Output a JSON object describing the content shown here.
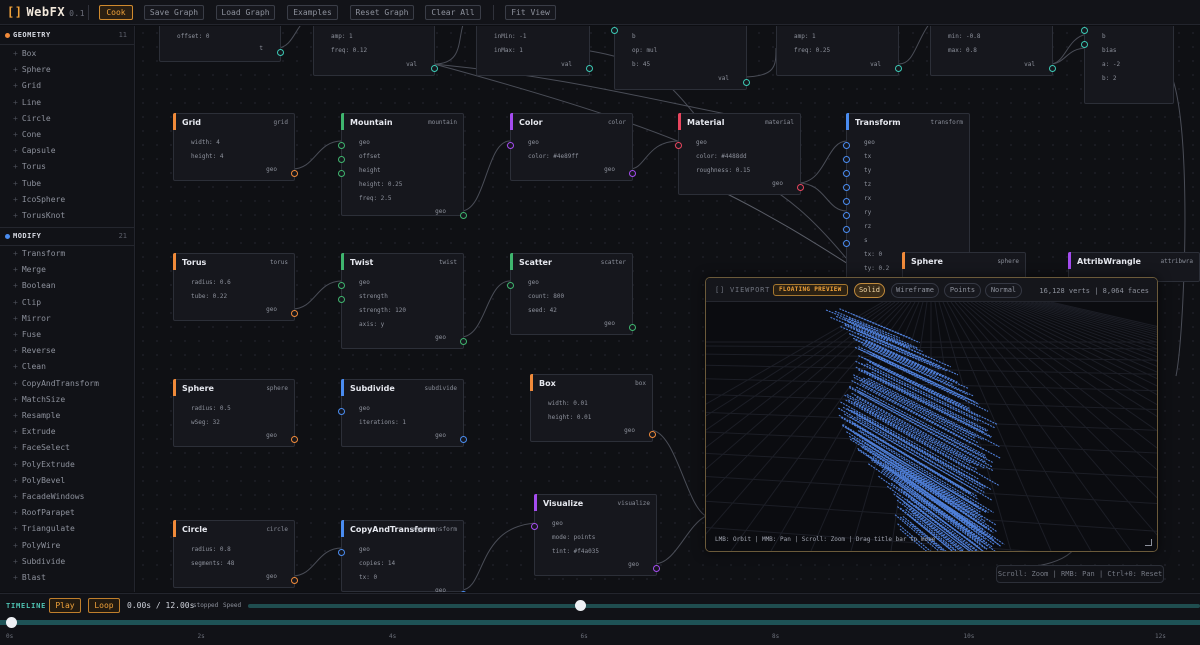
{
  "app": {
    "logo": "[]",
    "title": "WebFX",
    "version": "0.1"
  },
  "toolbar": {
    "cook": "Cook",
    "save": "Save Graph",
    "load": "Load Graph",
    "examples": "Examples",
    "reset": "Reset Graph",
    "clear": "Clear All",
    "fit": "Fit View"
  },
  "sidebar": {
    "geometry": {
      "label": "GEOMETRY",
      "count": "11",
      "color": "#f08a3a",
      "items": [
        "Box",
        "Sphere",
        "Grid",
        "Line",
        "Circle",
        "Cone",
        "Capsule",
        "Torus",
        "Tube",
        "IcoSphere",
        "TorusKnot"
      ]
    },
    "modify": {
      "label": "MODIFY",
      "count": "21",
      "color": "#4a8cf0",
      "items": [
        "Transform",
        "Merge",
        "Boolean",
        "Clip",
        "Mirror",
        "Fuse",
        "Reverse",
        "Clean",
        "CopyAndTransform",
        "MatchSize",
        "Resample",
        "Extrude",
        "FaceSelect",
        "PolyExtrude",
        "PolyBevel",
        "FacadeWindows",
        "RoofParapet",
        "Triangulate",
        "PolyWire",
        "Subdivide",
        "Blast"
      ]
    }
  },
  "nodes": {
    "top1": {
      "params": [
        "offset: 0"
      ],
      "out": "t"
    },
    "top2": {
      "params": [
        "amp: 1",
        "freq: 0.12"
      ],
      "out": "val"
    },
    "top3": {
      "params": [
        "inMin: -1",
        "inMax: 1"
      ],
      "out": "val"
    },
    "top4": {
      "params": [
        "b",
        "op: mul",
        "b: 45"
      ],
      "out": "val"
    },
    "top5": {
      "params": [
        "amp: 1",
        "freq: 0.25"
      ],
      "out": "val"
    },
    "top6": {
      "params": [
        "min: -0.8",
        "max: 0.8"
      ],
      "out": "val"
    },
    "top7": {
      "params": [
        "b",
        "bias",
        "a: -2",
        "b: 2"
      ]
    },
    "grid": {
      "title": "Grid",
      "type": "grid",
      "params": [
        "width: 4",
        "height: 4"
      ],
      "out": "geo"
    },
    "mountain": {
      "title": "Mountain",
      "type": "mountain",
      "params": [
        "geo",
        "offset",
        "height",
        "height: 0.25",
        "freq: 2.5"
      ],
      "out": "geo"
    },
    "color": {
      "title": "Color",
      "type": "color",
      "params": [
        "geo",
        "color: #4e89ff"
      ],
      "out": "geo"
    },
    "material": {
      "title": "Material",
      "type": "material",
      "params": [
        "geo",
        "color: #4488dd",
        "roughness: 0.15"
      ],
      "out": "geo"
    },
    "transform": {
      "title": "Transform",
      "type": "transform",
      "params": [
        "geo",
        "tx",
        "ty",
        "tz",
        "rx",
        "ry",
        "rz",
        "s",
        "tx: 0",
        "ty: 0.2"
      ]
    },
    "sphere2": {
      "title": "Sphere",
      "type": "sphere"
    },
    "attrib": {
      "title": "AttribWrangle",
      "type": "attribwra"
    },
    "torus": {
      "title": "Torus",
      "type": "torus",
      "params": [
        "radius: 0.6",
        "tube: 0.22"
      ],
      "out": "geo"
    },
    "twist": {
      "title": "Twist",
      "type": "twist",
      "params": [
        "geo",
        "strength",
        "strength: 120",
        "axis: y"
      ],
      "out": "geo"
    },
    "scatter": {
      "title": "Scatter",
      "type": "scatter",
      "params": [
        "geo",
        "count: 800",
        "seed: 42"
      ],
      "out": "geo"
    },
    "sphere": {
      "title": "Sphere",
      "type": "sphere",
      "params": [
        "radius: 0.5",
        "wSeg: 32"
      ],
      "out": "geo"
    },
    "subdivide": {
      "title": "Subdivide",
      "type": "subdivide",
      "params": [
        "geo",
        "iterations: 1"
      ],
      "out": "geo"
    },
    "box": {
      "title": "Box",
      "type": "box",
      "params": [
        "width: 0.01",
        "height: 0.01"
      ],
      "out": "geo"
    },
    "visualize": {
      "title": "Visualize",
      "type": "visualize",
      "params": [
        "geo",
        "mode: points",
        "tint: #f4a035"
      ],
      "out": "geo"
    },
    "circle": {
      "title": "Circle",
      "type": "circle",
      "params": [
        "radius: 0.8",
        "segments: 48"
      ],
      "out": "geo"
    },
    "copy": {
      "title": "CopyAndTransform",
      "type": "copytransform",
      "params": [
        "geo",
        "copies: 14",
        "tx: 0"
      ],
      "out": "geo"
    }
  },
  "viewport": {
    "title": "[] VIEWPORT",
    "badge": "FLOATING PREVIEW",
    "modes": [
      "Solid",
      "Wireframe",
      "Points",
      "Normal"
    ],
    "active_mode": "Solid",
    "stats": "16,128 verts | 8,064 faces",
    "help": "LMB: Orbit | MMB: Pan | Scroll: Zoom | Drag title bar to move"
  },
  "canvas_hint": "Scroll: Zoom | RMB: Pan | Ctrl+0: Reset",
  "timeline": {
    "label": "TIMELINE",
    "play": "Play",
    "loop": "Loop",
    "time": "0.00s / 12.00s",
    "state": "stopped",
    "speed_label": "Speed",
    "progress": 0,
    "ticks": [
      "0s",
      "2s",
      "4s",
      "6s",
      "8s",
      "10s",
      "12s"
    ]
  },
  "colors": {
    "geometry": "#f08a3a",
    "modify": "#4a8cf0",
    "mountain": "#3fb56e",
    "color": "#a54cf0",
    "material": "#e8455e",
    "teal": "#3cc9b5"
  }
}
